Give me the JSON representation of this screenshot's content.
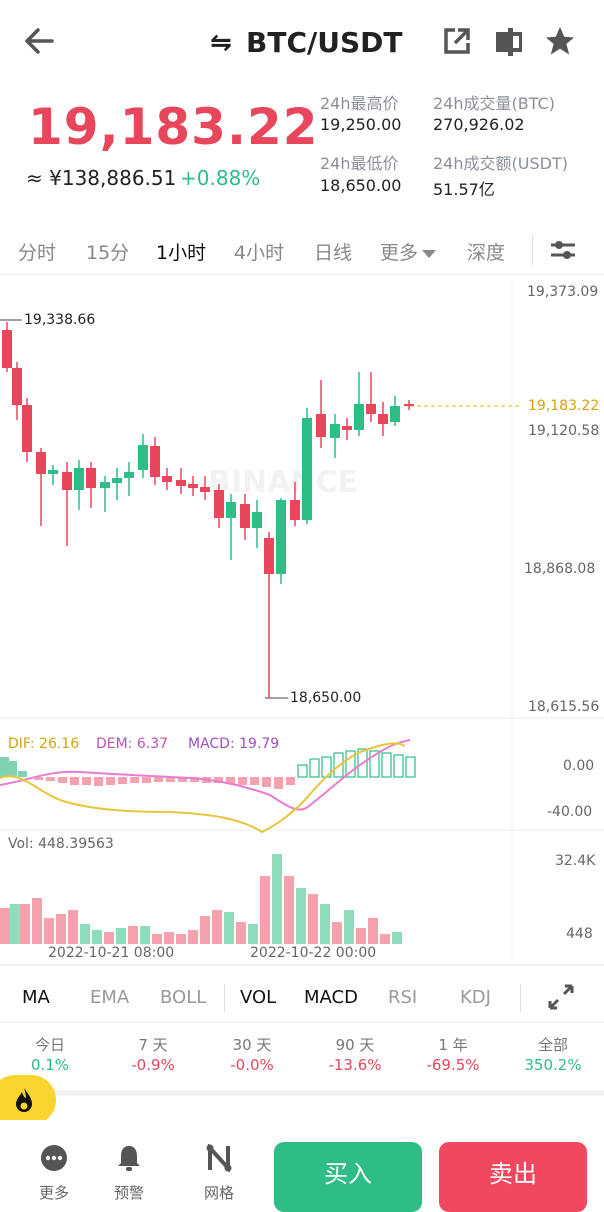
{
  "header": {
    "pair": "BTC/USDT",
    "swap_glyph": "⇋"
  },
  "ticker": {
    "last_price": "19,183.22",
    "cny_price": "≈ ¥138,886.51",
    "change_pct": "+0.88%",
    "high_label": "24h最高价",
    "high_value": "19,250.00",
    "low_label": "24h最低价",
    "low_value": "18,650.00",
    "vol_label": "24h成交量(BTC)",
    "vol_value": "270,926.02",
    "turnover_label": "24h成交额(USDT)",
    "turnover_value": "51.57亿"
  },
  "tabs": [
    "分时",
    "15分",
    "1小时",
    "4小时",
    "日线",
    "更多",
    "深度"
  ],
  "active_tab": "1小时",
  "chart": {
    "y_top": "19,373.09",
    "y_current": "19,183.22",
    "y_mid1": "19,120.58",
    "y_mid2": "18,868.08",
    "y_bottom": "18,615.56",
    "high_marker": "19,338.66",
    "low_marker": "18,650.00",
    "watermark": "BINANCE"
  },
  "macd": {
    "dif": "DIF: 26.16",
    "dem": "DEM: 6.37",
    "macd": "MACD: 19.79",
    "y0": "0.00",
    "y1": "-40.00"
  },
  "volume": {
    "label": "Vol: 448.39563",
    "y_top": "32.4K",
    "y_bottom": "448",
    "date1": "2022-10-21 08:00",
    "date2": "2022-10-22 00:00"
  },
  "indicators": [
    "MA",
    "EMA",
    "BOLL",
    "VOL",
    "MACD",
    "RSI",
    "KDJ"
  ],
  "periods": [
    {
      "label": "今日",
      "value": "0.1%",
      "color": "#2ebd85"
    },
    {
      "label": "7 天",
      "value": "-0.9%",
      "color": "#e8475b"
    },
    {
      "label": "30 天",
      "value": "-0.0%",
      "color": "#e8475b"
    },
    {
      "label": "90 天",
      "value": "-13.6%",
      "color": "#e8475b"
    },
    {
      "label": "1 年",
      "value": "-69.5%",
      "color": "#e8475b"
    },
    {
      "label": "全部",
      "value": "350.2%",
      "color": "#2ebd85"
    }
  ],
  "bottom": {
    "more": "更多",
    "alert": "预警",
    "grid": "网格",
    "buy": "买入",
    "sell": "卖出"
  },
  "colors": {
    "up": "#2ebd85",
    "down": "#e8475b",
    "accent": "#f0b90b"
  }
}
